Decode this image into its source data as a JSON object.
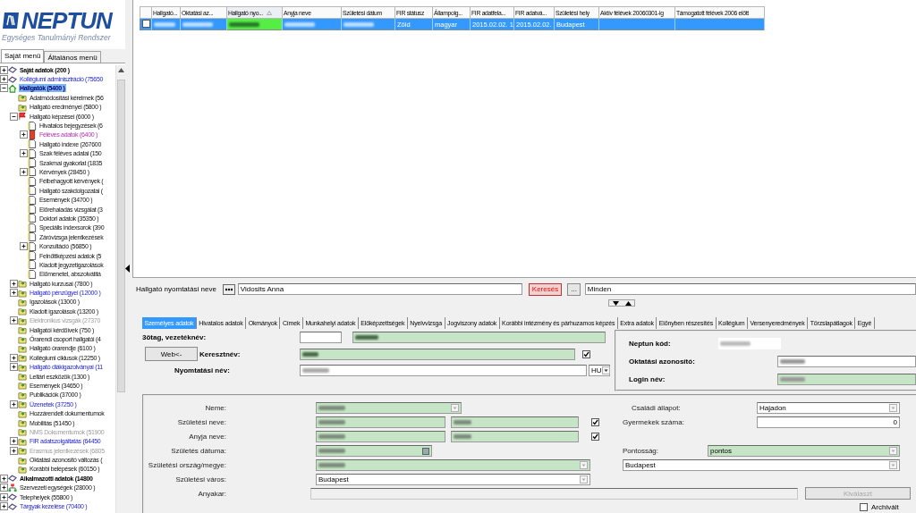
{
  "logo": {
    "title": "NEPTUN",
    "subtitle": "Egységes Tanulmányi Rendszer"
  },
  "menu_tabs": [
    {
      "label": "Saját menü",
      "selected": true
    },
    {
      "label": "Általános menü",
      "selected": false
    }
  ],
  "tree": [
    {
      "label": "Saját adatok (200 )",
      "kind": "bold",
      "expandable": true,
      "expanded": false,
      "selected": false
    },
    {
      "label": "Kollégiumi adminisztráció (75650",
      "kind": "link",
      "expandable": true,
      "expanded": false,
      "selected": false
    },
    {
      "label": "Hallgatók (5400 )",
      "kind": "bold",
      "expandable": true,
      "expanded": true,
      "selected": true,
      "children": [
        {
          "label": "Adatmódosítási kérelmek (56",
          "kind": "plain",
          "expandable": false,
          "expanded": false,
          "selected": false
        },
        {
          "label": "Hallgató eredményei (5800 )",
          "kind": "plain",
          "expandable": false,
          "expanded": false,
          "selected": false
        },
        {
          "label": "Hallgató képzései (6000 )",
          "kind": "plain",
          "expandable": true,
          "expanded": true,
          "selected": false,
          "children": [
            {
              "label": "Hivatalos bejegyzések (6",
              "kind": "plain",
              "expandable": false,
              "expanded": false,
              "selected": false
            },
            {
              "label": "Féléves adatok (6400 )",
              "kind": "special",
              "expandable": true,
              "expanded": false,
              "selected": false
            },
            {
              "label": "Hallgató indexe (267600",
              "kind": "plain",
              "expandable": false,
              "expanded": false,
              "selected": false
            },
            {
              "label": "Szak féléves adatai (150",
              "kind": "plain",
              "expandable": true,
              "expanded": false,
              "selected": false
            },
            {
              "label": "Szakmai gyakorlat (1835",
              "kind": "plain",
              "expandable": false,
              "expanded": false,
              "selected": false
            },
            {
              "label": "Kérvények (28450 )",
              "kind": "plain",
              "expandable": true,
              "expanded": false,
              "selected": false
            },
            {
              "label": "Félbehagyott kérvények (",
              "kind": "plain",
              "expandable": false,
              "expanded": false,
              "selected": false
            },
            {
              "label": "Hallgató szakdolgozatai (",
              "kind": "plain",
              "expandable": false,
              "expanded": false,
              "selected": false
            },
            {
              "label": "Események (34700 )",
              "kind": "plain",
              "expandable": false,
              "expanded": false,
              "selected": false
            },
            {
              "label": "Előrehaladás vizsgálat (3",
              "kind": "plain",
              "expandable": false,
              "expanded": false,
              "selected": false
            },
            {
              "label": "Doktori adatok (35350 )",
              "kind": "plain",
              "expandable": false,
              "expanded": false,
              "selected": false
            },
            {
              "label": "Speciális indexsorok (390",
              "kind": "plain",
              "expandable": false,
              "expanded": false,
              "selected": false
            },
            {
              "label": "Záróvizsga jelentkezések",
              "kind": "plain",
              "expandable": false,
              "expanded": false,
              "selected": false
            },
            {
              "label": "Konzultáció (56850 )",
              "kind": "plain",
              "expandable": true,
              "expanded": false,
              "selected": false
            },
            {
              "label": "Felnőttképzési adatok (5",
              "kind": "plain",
              "expandable": false,
              "expanded": false,
              "selected": false
            },
            {
              "label": "Kiadott jegyzetigazolások",
              "kind": "plain",
              "expandable": false,
              "expanded": false,
              "selected": false
            },
            {
              "label": "Előmenetel, abszolvátitá",
              "kind": "plain",
              "expandable": false,
              "expanded": false,
              "selected": false
            }
          ]
        },
        {
          "label": "Hallgató kurzusai (7800 )",
          "kind": "plain",
          "expandable": true,
          "expanded": false,
          "selected": false
        },
        {
          "label": "Hallgató pénzügyei (12000 )",
          "kind": "link",
          "expandable": true,
          "expanded": false,
          "selected": false
        },
        {
          "label": "Igazolások (13000 )",
          "kind": "plain",
          "expandable": false,
          "expanded": false,
          "selected": false
        },
        {
          "label": "Kiadott igazolások (13200 )",
          "kind": "plain",
          "expandable": false,
          "expanded": false,
          "selected": false
        },
        {
          "label": "Elektronikus vizsgák (27370",
          "kind": "disabled",
          "expandable": true,
          "expanded": false,
          "selected": false
        },
        {
          "label": "Hallgatói kérdőívek (750 )",
          "kind": "plain",
          "expandable": false,
          "expanded": false,
          "selected": false
        },
        {
          "label": "Órarendi csoport hallgatói (4",
          "kind": "plain",
          "expandable": false,
          "expanded": false,
          "selected": false
        },
        {
          "label": "Hallgató órarendje (6100 )",
          "kind": "plain",
          "expandable": false,
          "expanded": false,
          "selected": false
        },
        {
          "label": "Kollégiumi ciklusok (12250 )",
          "kind": "plain",
          "expandable": true,
          "expanded": false,
          "selected": false
        },
        {
          "label": "Hallgató diákigazolványai (11",
          "kind": "link",
          "expandable": true,
          "expanded": false,
          "selected": false
        },
        {
          "label": "Leltári eszközök (1300 )",
          "kind": "plain",
          "expandable": false,
          "expanded": false,
          "selected": false
        },
        {
          "label": "Események (34650 )",
          "kind": "plain",
          "expandable": false,
          "expanded": false,
          "selected": false
        },
        {
          "label": "Publikációk (37000 )",
          "kind": "plain",
          "expandable": false,
          "expanded": false,
          "selected": false
        },
        {
          "label": "Üzenetek (37250 )",
          "kind": "link",
          "expandable": true,
          "expanded": false,
          "selected": false
        },
        {
          "label": "Hozzárendelt dokumentumok",
          "kind": "plain",
          "expandable": false,
          "expanded": false,
          "selected": false
        },
        {
          "label": "Mobilitás (51450 )",
          "kind": "plain",
          "expandable": false,
          "expanded": false,
          "selected": false
        },
        {
          "label": "NMS Dokumentumok (51900",
          "kind": "disabled",
          "expandable": false,
          "expanded": false,
          "selected": false
        },
        {
          "label": "FIR adatszolgáltatás (64450",
          "kind": "link",
          "expandable": true,
          "expanded": false,
          "selected": false
        },
        {
          "label": "Erasmus jelentkezések (6805",
          "kind": "disabled",
          "expandable": true,
          "expanded": false,
          "selected": false
        },
        {
          "label": "Oktatási azonosító változás (",
          "kind": "plain",
          "expandable": false,
          "expanded": false,
          "selected": false
        },
        {
          "label": "Korábbi belépések (60150 )",
          "kind": "plain",
          "expandable": false,
          "expanded": false,
          "selected": false
        }
      ]
    },
    {
      "label": "Alkalmazotti adatok (14800",
      "kind": "bold",
      "expandable": true,
      "expanded": false,
      "selected": false
    },
    {
      "label": "Szervezeti egységek (28000 )",
      "kind": "plain",
      "expandable": true,
      "expanded": false,
      "selected": false
    },
    {
      "label": "Telephelyek (55800 )",
      "kind": "plain",
      "expandable": true,
      "expanded": false,
      "selected": false
    },
    {
      "label": "Tárgyak kezelése (70400 )",
      "kind": "link",
      "expandable": true,
      "expanded": false,
      "selected": false
    }
  ],
  "grid": {
    "columns": [
      {
        "label": "Hallgató...",
        "sorted": false
      },
      {
        "label": "Oktatási az...",
        "sorted": false
      },
      {
        "label": "Hallgató nyo...",
        "sorted": true
      },
      {
        "label": "Anyja neve",
        "sorted": false
      },
      {
        "label": "Születési dátum",
        "sorted": false
      },
      {
        "label": "FIR státusz",
        "sorted": false
      },
      {
        "label": "Állampolg...",
        "sorted": false
      },
      {
        "label": "FIR adatfela...",
        "sorted": false
      },
      {
        "label": "FIR adatvá...",
        "sorted": false
      },
      {
        "label": "Születési hely",
        "sorted": false
      },
      {
        "label": "Aktív félévek 20060301-ig",
        "sorted": false
      },
      {
        "label": "Támogatott félévek 2006 előtt",
        "sorted": false
      }
    ],
    "rows": [
      {
        "selected": true,
        "checked": false,
        "cells": [
          {
            "kind": "masked"
          },
          {
            "kind": "masked"
          },
          {
            "kind": "masked",
            "color": "#55ee44"
          },
          {
            "kind": "masked"
          },
          {
            "kind": "masked"
          },
          {
            "kind": "text",
            "text": "Zöld"
          },
          {
            "kind": "text",
            "text": "magyar"
          },
          {
            "kind": "text",
            "text": "2015.02.02. 1"
          },
          {
            "kind": "text",
            "text": "2015.02.02."
          },
          {
            "kind": "text",
            "text": "Budapest"
          },
          {
            "kind": "empty"
          },
          {
            "kind": "empty"
          }
        ]
      }
    ]
  },
  "search": {
    "label": "Hallgató nyomtatási neve",
    "value": "Vidosits Anna",
    "search_button": "Keresés",
    "filter_button": "...",
    "filter_value": "Minden"
  },
  "detail_tabs": [
    {
      "label": "Személyes adatok",
      "selected": true
    },
    {
      "label": "Hivatalos adatok",
      "selected": false
    },
    {
      "label": "Okmányok",
      "selected": false
    },
    {
      "label": "Címek",
      "selected": false
    },
    {
      "label": "Munkahelyi adatok",
      "selected": false
    },
    {
      "label": "Előképzettségek",
      "selected": false
    },
    {
      "label": "Nyelvvizsga",
      "selected": false
    },
    {
      "label": "Jogviszony adatok",
      "selected": false
    },
    {
      "label": "Korábbi intézmény és párhuzamos képzés",
      "selected": false
    },
    {
      "label": "Extra adatok",
      "selected": false
    },
    {
      "label": "Előnyben részesítés",
      "selected": false
    },
    {
      "label": "Kollégium",
      "selected": false
    },
    {
      "label": "Versenyeredmények",
      "selected": false
    },
    {
      "label": "Törzslapátlagok",
      "selected": false
    },
    {
      "label": "Egyé",
      "selected": false
    }
  ],
  "name_block": {
    "surname": {
      "label": "3ötag, vezetéknév:",
      "required": true,
      "masked": true
    },
    "web_button": "Web<-",
    "given": {
      "label": "Keresztnév:",
      "required": true,
      "masked": true,
      "checked": true
    },
    "print": {
      "label": "Nyomtatási név:",
      "required": false,
      "masked": true,
      "language": "HU"
    }
  },
  "ids": [
    {
      "label": "Neptun kód:",
      "kind": "readonly",
      "masked": true
    },
    {
      "label": "Oktatási azonosító:",
      "kind": "field",
      "required": false,
      "masked": true
    },
    {
      "label": "Login név:",
      "kind": "field",
      "required": true,
      "masked": true
    }
  ],
  "details_left": [
    {
      "label": "Neme:",
      "kind": "select",
      "required": true
    },
    {
      "label": "Születési neve:",
      "kind": "pair",
      "required": true,
      "checked": true
    },
    {
      "label": "Anyja neve:",
      "kind": "pair",
      "required": true,
      "checked": true
    },
    {
      "label": "Születés dátuma:",
      "kind": "date",
      "required": true
    },
    {
      "label": "Születési ország/megye:",
      "kind": "select",
      "required": true
    },
    {
      "label": "Születési város:",
      "kind": "select",
      "required": false,
      "value": "Budapest"
    },
    {
      "label": "Anyakar:",
      "kind": "text",
      "required": false
    }
  ],
  "details_right": [
    {
      "label": "Családi állapot:",
      "kind": "select",
      "required": false,
      "value": "Hajadon"
    },
    {
      "label": "Gyermekek száma:",
      "kind": "number",
      "required": false,
      "value": "0"
    },
    {
      "label": "Pontosság:",
      "kind": "select",
      "required": true,
      "value": "pontos"
    },
    {
      "kind": "select",
      "required": false,
      "value": "Budapest"
    }
  ],
  "choose_button": {
    "label": "Kiválaszt",
    "disabled": true
  },
  "archived": {
    "label": "Archivált",
    "checked": false
  }
}
